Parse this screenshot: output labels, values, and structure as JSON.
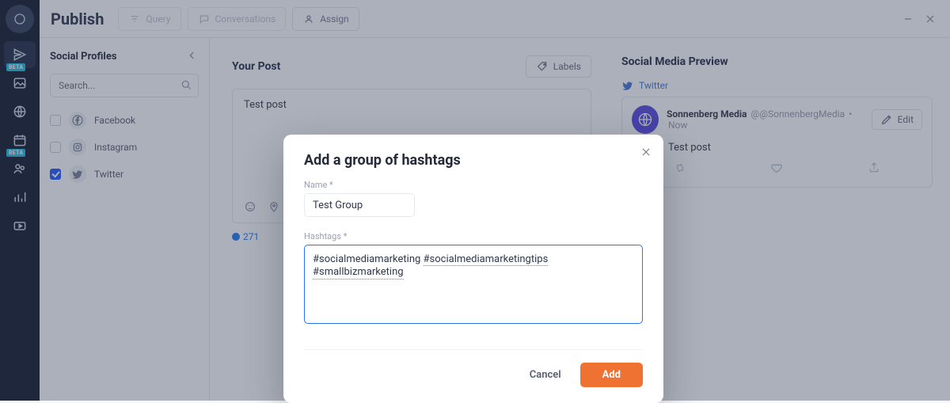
{
  "header": {
    "title": "Publish",
    "btn_query": "Query",
    "btn_conversations": "Conversations",
    "btn_assign": "Assign"
  },
  "sidebar": {
    "title": "Social Profiles",
    "search_placeholder": "Search...",
    "profiles": [
      {
        "label": "Facebook",
        "checked": false
      },
      {
        "label": "Instagram",
        "checked": false
      },
      {
        "label": "Twitter",
        "checked": true
      }
    ]
  },
  "rail_badge": "BETA",
  "compose": {
    "heading": "Your Post",
    "labels_btn": "Labels",
    "text": "Test post",
    "char_count": "271"
  },
  "preview": {
    "heading": "Social Media Preview",
    "platform": "Twitter",
    "account_name": "Sonnenberg Media",
    "account_handle": "@@SonnenbergMedia",
    "time_sep": " • ",
    "time": "Now",
    "edit_btn": "Edit",
    "body": "Test post"
  },
  "modal": {
    "title": "Add a group of hashtags",
    "name_label": "Name *",
    "name_value": "Test Group",
    "hashtags_label": "Hashtags *",
    "hashtags_prefix": "#socialmediamarketing ",
    "hashtags_w1": "#socialmediamarketingtips",
    "hashtags_sep": " ",
    "hashtags_w2": "#smallbizmarketing",
    "cancel": "Cancel",
    "add": "Add"
  }
}
